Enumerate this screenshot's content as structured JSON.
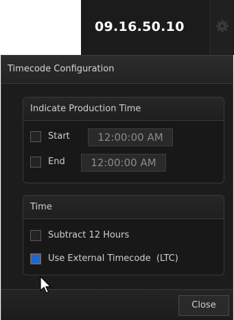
{
  "header": {
    "timecode": "09.16.50.10",
    "settings_icon": "gear-icon"
  },
  "panel": {
    "title": "Timecode Configuration",
    "production_time": {
      "heading": "Indicate Production Time",
      "start": {
        "label": "Start",
        "value": "12:00:00 AM",
        "checked": false
      },
      "end": {
        "label": "End",
        "value": "12:00:00 AM",
        "checked": false
      }
    },
    "time": {
      "heading": "Time",
      "subtract_12_hours": {
        "label": "Subtract 12 Hours",
        "checked": false
      },
      "use_external_timecode": {
        "label": "Use External Timecode  (LTC)",
        "checked": true
      }
    },
    "close_label": "Close"
  },
  "colors": {
    "checkbox_checked": "#1f66c8",
    "panel_background": "#1c1c1c",
    "topbar_background": "#1b1b1b"
  },
  "cursor_icon": "arrow-cursor-icon"
}
